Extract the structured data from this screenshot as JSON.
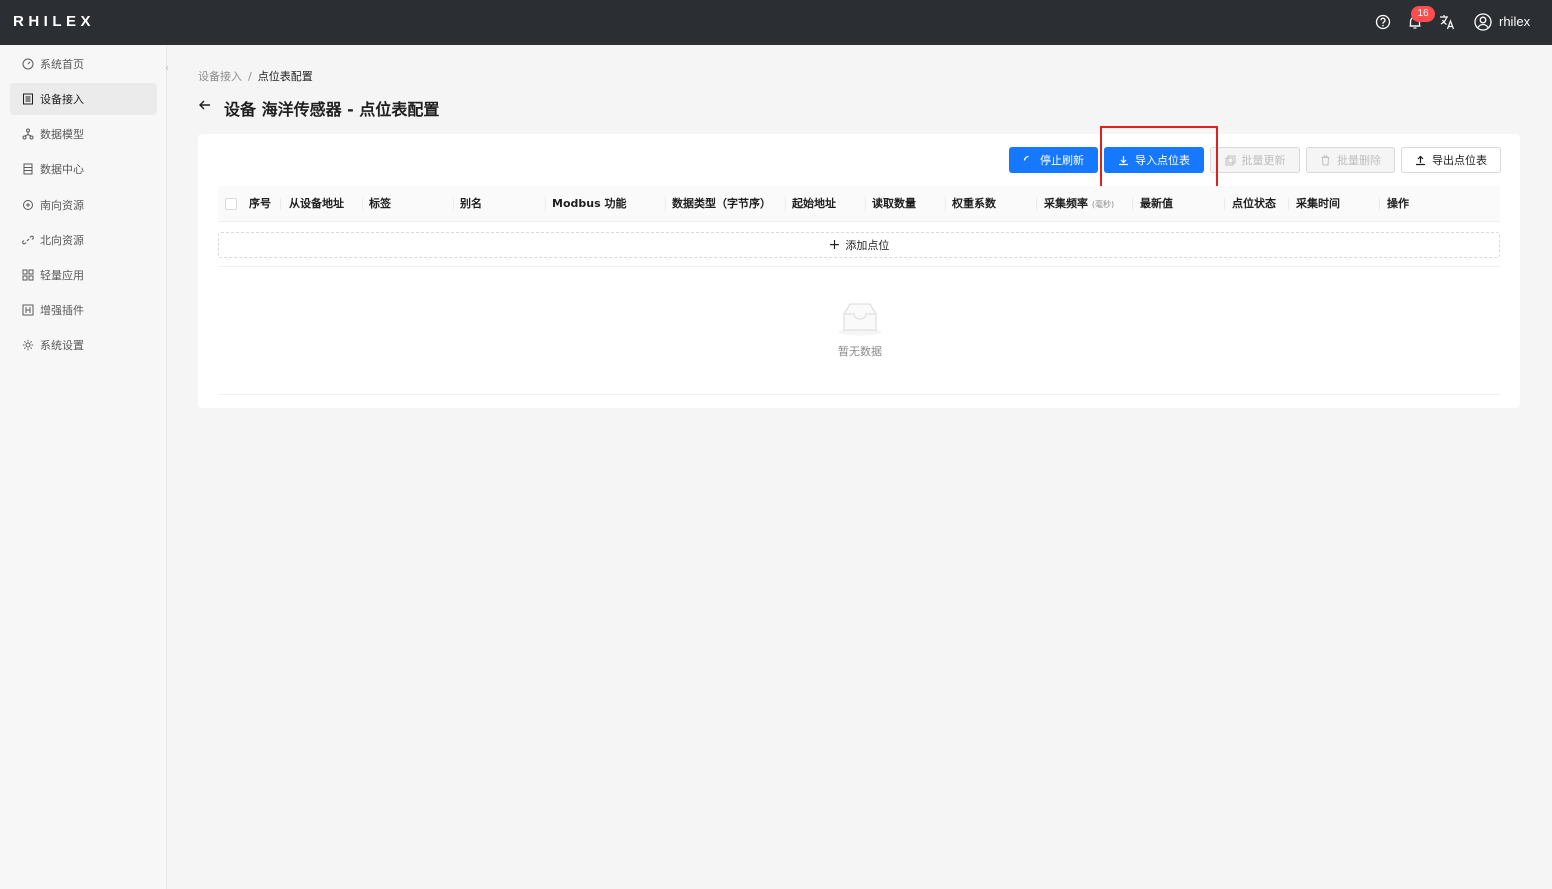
{
  "app": {
    "logo": "RHILEX",
    "username": "rhilex",
    "notification_count": "16"
  },
  "sidebar": {
    "items": [
      {
        "label": "系统首页",
        "icon": "dashboard-icon"
      },
      {
        "label": "设备接入",
        "icon": "device-icon",
        "active": true
      },
      {
        "label": "数据模型",
        "icon": "cluster-icon"
      },
      {
        "label": "数据中心",
        "icon": "database-icon"
      },
      {
        "label": "南向资源",
        "icon": "api-icon"
      },
      {
        "label": "北向资源",
        "icon": "link-icon"
      },
      {
        "label": "轻量应用",
        "icon": "appstore-icon"
      },
      {
        "label": "增强插件",
        "icon": "plugin-icon"
      },
      {
        "label": "系统设置",
        "icon": "gear-icon"
      }
    ]
  },
  "breadcrumb": {
    "parent": "设备接入",
    "separator": "/",
    "current": "点位表配置"
  },
  "page": {
    "title": "设备 海洋传感器 - 点位表配置"
  },
  "toolbar": {
    "stop_refresh": "停止刷新",
    "import": "导入点位表",
    "batch_update": "批量更新",
    "batch_delete": "批量删除",
    "export": "导出点位表"
  },
  "table": {
    "columns": {
      "index": "序号",
      "slave_addr": "从设备地址",
      "tag": "标签",
      "alias": "别名",
      "modbus_func": "Modbus 功能",
      "data_type": "数据类型（字节序）",
      "start_addr": "起始地址",
      "read_count": "读取数量",
      "weight": "权重系数",
      "freq": "采集频率",
      "freq_unit": "(毫秒)",
      "latest": "最新值",
      "status": "点位状态",
      "time": "采集时间",
      "actions": "操作"
    },
    "add_label": "添加点位",
    "empty_text": "暂无数据"
  },
  "colors": {
    "primary": "#1677ff",
    "topbar": "#2b2e33",
    "badge": "#ff4d4f",
    "highlight": "#e02020"
  }
}
